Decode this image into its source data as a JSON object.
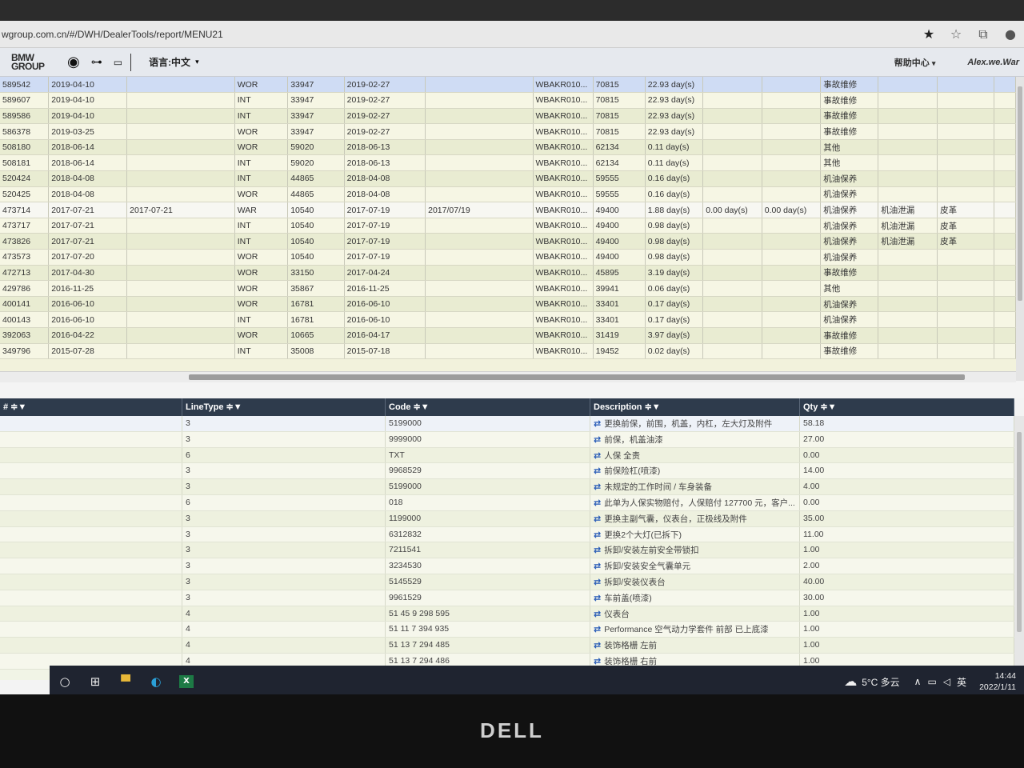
{
  "browser": {
    "url": "wgroup.com.cn/#/DWH/DealerTools/report/MENU21"
  },
  "app": {
    "logo": "BMW GROUP",
    "language": "语言:中文",
    "help": "帮助中心",
    "user": "Alex.we.War"
  },
  "top_rows": [
    {
      "id": "589542",
      "date1": "2019-04-10",
      "date2": "",
      "type": "WOR",
      "code": "33947",
      "date3": "2019-02-27",
      "date4": "",
      "vin": "WBAKR010...",
      "km": "70815",
      "d1": "22.93 day(s)",
      "d2": "",
      "d3": "",
      "cat": "事故维修",
      "sub": "",
      "ex": ""
    },
    {
      "id": "589607",
      "date1": "2019-04-10",
      "date2": "",
      "type": "INT",
      "code": "33947",
      "date3": "2019-02-27",
      "date4": "",
      "vin": "WBAKR010...",
      "km": "70815",
      "d1": "22.93 day(s)",
      "d2": "",
      "d3": "",
      "cat": "事故维修",
      "sub": "",
      "ex": ""
    },
    {
      "id": "589586",
      "date1": "2019-04-10",
      "date2": "",
      "type": "INT",
      "code": "33947",
      "date3": "2019-02-27",
      "date4": "",
      "vin": "WBAKR010...",
      "km": "70815",
      "d1": "22.93 day(s)",
      "d2": "",
      "d3": "",
      "cat": "事故维修",
      "sub": "",
      "ex": ""
    },
    {
      "id": "586378",
      "date1": "2019-03-25",
      "date2": "",
      "type": "WOR",
      "code": "33947",
      "date3": "2019-02-27",
      "date4": "",
      "vin": "WBAKR010...",
      "km": "70815",
      "d1": "22.93 day(s)",
      "d2": "",
      "d3": "",
      "cat": "事故维修",
      "sub": "",
      "ex": ""
    },
    {
      "id": "508180",
      "date1": "2018-06-14",
      "date2": "",
      "type": "WOR",
      "code": "59020",
      "date3": "2018-06-13",
      "date4": "",
      "vin": "WBAKR010...",
      "km": "62134",
      "d1": "0.11 day(s)",
      "d2": "",
      "d3": "",
      "cat": "其他",
      "sub": "",
      "ex": ""
    },
    {
      "id": "508181",
      "date1": "2018-06-14",
      "date2": "",
      "type": "INT",
      "code": "59020",
      "date3": "2018-06-13",
      "date4": "",
      "vin": "WBAKR010...",
      "km": "62134",
      "d1": "0.11 day(s)",
      "d2": "",
      "d3": "",
      "cat": "其他",
      "sub": "",
      "ex": ""
    },
    {
      "id": "520424",
      "date1": "2018-04-08",
      "date2": "",
      "type": "INT",
      "code": "44865",
      "date3": "2018-04-08",
      "date4": "",
      "vin": "WBAKR010...",
      "km": "59555",
      "d1": "0.16 day(s)",
      "d2": "",
      "d3": "",
      "cat": "机油保养",
      "sub": "",
      "ex": ""
    },
    {
      "id": "520425",
      "date1": "2018-04-08",
      "date2": "",
      "type": "WOR",
      "code": "44865",
      "date3": "2018-04-08",
      "date4": "",
      "vin": "WBAKR010...",
      "km": "59555",
      "d1": "0.16 day(s)",
      "d2": "",
      "d3": "",
      "cat": "机油保养",
      "sub": "",
      "ex": ""
    },
    {
      "id": "473714",
      "date1": "2017-07-21",
      "date2": "2017-07-21",
      "type": "WAR",
      "code": "10540",
      "date3": "2017-07-19",
      "date4": "2017/07/19",
      "vin": "WBAKR010...",
      "km": "49400",
      "d1": "1.88 day(s)",
      "d2": "0.00 day(s)",
      "d3": "0.00 day(s)",
      "cat": "机油保养",
      "sub": "机油泄漏",
      "ex": "皮革"
    },
    {
      "id": "473717",
      "date1": "2017-07-21",
      "date2": "",
      "type": "INT",
      "code": "10540",
      "date3": "2017-07-19",
      "date4": "",
      "vin": "WBAKR010...",
      "km": "49400",
      "d1": "0.98 day(s)",
      "d2": "",
      "d3": "",
      "cat": "机油保养",
      "sub": "机油泄漏",
      "ex": "皮革"
    },
    {
      "id": "473826",
      "date1": "2017-07-21",
      "date2": "",
      "type": "INT",
      "code": "10540",
      "date3": "2017-07-19",
      "date4": "",
      "vin": "WBAKR010...",
      "km": "49400",
      "d1": "0.98 day(s)",
      "d2": "",
      "d3": "",
      "cat": "机油保养",
      "sub": "机油泄漏",
      "ex": "皮革"
    },
    {
      "id": "473573",
      "date1": "2017-07-20",
      "date2": "",
      "type": "WOR",
      "code": "10540",
      "date3": "2017-07-19",
      "date4": "",
      "vin": "WBAKR010...",
      "km": "49400",
      "d1": "0.98 day(s)",
      "d2": "",
      "d3": "",
      "cat": "机油保养",
      "sub": "",
      "ex": ""
    },
    {
      "id": "472713",
      "date1": "2017-04-30",
      "date2": "",
      "type": "WOR",
      "code": "33150",
      "date3": "2017-04-24",
      "date4": "",
      "vin": "WBAKR010...",
      "km": "45895",
      "d1": "3.19 day(s)",
      "d2": "",
      "d3": "",
      "cat": "事故维修",
      "sub": "",
      "ex": ""
    },
    {
      "id": "429786",
      "date1": "2016-11-25",
      "date2": "",
      "type": "WOR",
      "code": "35867",
      "date3": "2016-11-25",
      "date4": "",
      "vin": "WBAKR010...",
      "km": "39941",
      "d1": "0.06 day(s)",
      "d2": "",
      "d3": "",
      "cat": "其他",
      "sub": "",
      "ex": ""
    },
    {
      "id": "400141",
      "date1": "2016-06-10",
      "date2": "",
      "type": "WOR",
      "code": "16781",
      "date3": "2016-06-10",
      "date4": "",
      "vin": "WBAKR010...",
      "km": "33401",
      "d1": "0.17 day(s)",
      "d2": "",
      "d3": "",
      "cat": "机油保养",
      "sub": "",
      "ex": ""
    },
    {
      "id": "400143",
      "date1": "2016-06-10",
      "date2": "",
      "type": "INT",
      "code": "16781",
      "date3": "2016-06-10",
      "date4": "",
      "vin": "WBAKR010...",
      "km": "33401",
      "d1": "0.17 day(s)",
      "d2": "",
      "d3": "",
      "cat": "机油保养",
      "sub": "",
      "ex": ""
    },
    {
      "id": "392063",
      "date1": "2016-04-22",
      "date2": "",
      "type": "WOR",
      "code": "10665",
      "date3": "2016-04-17",
      "date4": "",
      "vin": "WBAKR010...",
      "km": "31419",
      "d1": "3.97 day(s)",
      "d2": "",
      "d3": "",
      "cat": "事故维修",
      "sub": "",
      "ex": ""
    },
    {
      "id": "349796",
      "date1": "2015-07-28",
      "date2": "",
      "type": "INT",
      "code": "35008",
      "date3": "2015-07-18",
      "date4": "",
      "vin": "WBAKR010...",
      "km": "19452",
      "d1": "0.02 day(s)",
      "d2": "",
      "d3": "",
      "cat": "事故维修",
      "sub": "",
      "ex": ""
    }
  ],
  "bottom_headers": {
    "num": "# ≑▼",
    "linetype": "LineType ≑▼",
    "code": "Code ≑▼",
    "description": "Description ≑▼",
    "qty": "Qty ≑▼"
  },
  "bottom_rows": [
    {
      "linetype": "3",
      "code": "5199000",
      "desc": "更换前保，前围，机盖，内杠，左大灯及附件",
      "qty": "58.18"
    },
    {
      "linetype": "3",
      "code": "9999000",
      "desc": "前保，机盖油漆",
      "qty": "27.00"
    },
    {
      "linetype": "6",
      "code": "TXT",
      "desc": "人保 全责",
      "qty": "0.00"
    },
    {
      "linetype": "3",
      "code": "9968529",
      "desc": "前保险杠(喷漆)",
      "qty": "14.00"
    },
    {
      "linetype": "3",
      "code": "5199000",
      "desc": "未规定的工作时间 / 车身装备",
      "qty": "4.00"
    },
    {
      "linetype": "6",
      "code": "018",
      "desc": "此单为人保实物赔付，人保赔付 127700 元，客户...",
      "qty": "0.00"
    },
    {
      "linetype": "3",
      "code": "1199000",
      "desc": "更换主副气囊，仪表台，正极线及附件",
      "qty": "35.00"
    },
    {
      "linetype": "3",
      "code": "6312832",
      "desc": "更换2个大灯(已拆下)",
      "qty": "11.00"
    },
    {
      "linetype": "3",
      "code": "7211541",
      "desc": "拆卸/安装左前安全带锁扣",
      "qty": "1.00"
    },
    {
      "linetype": "3",
      "code": "3234530",
      "desc": "拆卸/安装安全气囊单元",
      "qty": "2.00"
    },
    {
      "linetype": "3",
      "code": "5145529",
      "desc": "拆卸/安装仪表台",
      "qty": "40.00"
    },
    {
      "linetype": "3",
      "code": "9961529",
      "desc": "车前盖(喷漆)",
      "qty": "30.00"
    },
    {
      "linetype": "4",
      "code": "51 45 9 298 595",
      "desc": "仪表台",
      "qty": "1.00"
    },
    {
      "linetype": "4",
      "code": "51 11 7 394 935",
      "desc": "Performance 空气动力学套件 前部 已上底漆",
      "qty": "1.00"
    },
    {
      "linetype": "4",
      "code": "51 13 7 294 485",
      "desc": "装饰格栅 左前",
      "qty": "1.00"
    },
    {
      "linetype": "4",
      "code": "51 13 7 294 486",
      "desc": "装饰格栅 右前",
      "qty": "1.00"
    }
  ],
  "taskbar": {
    "weather": "5°C 多云",
    "ime": "英",
    "time": "14:44",
    "date": "2022/1/11"
  },
  "monitor": {
    "brand": "DELL"
  }
}
